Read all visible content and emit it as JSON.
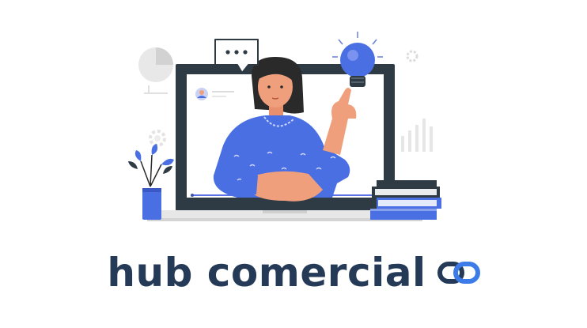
{
  "brand": {
    "name": "hub comercial",
    "logo_icon": "chain-link-icon"
  },
  "illustration": {
    "icons": [
      "pie-chart-icon",
      "speech-bubble-icon",
      "lightbulb-icon",
      "gear-icon",
      "bar-chart-icon",
      "flower-vase-icon",
      "book-stack-icon",
      "laptop-icon",
      "avatar-icon"
    ]
  },
  "colors": {
    "brand_dark": "#243a57",
    "accent_blue": "#4a6fe3",
    "skin": "#f09f7c",
    "laptop_frame": "#2f3b44",
    "light_gray": "#e6e6e6"
  }
}
